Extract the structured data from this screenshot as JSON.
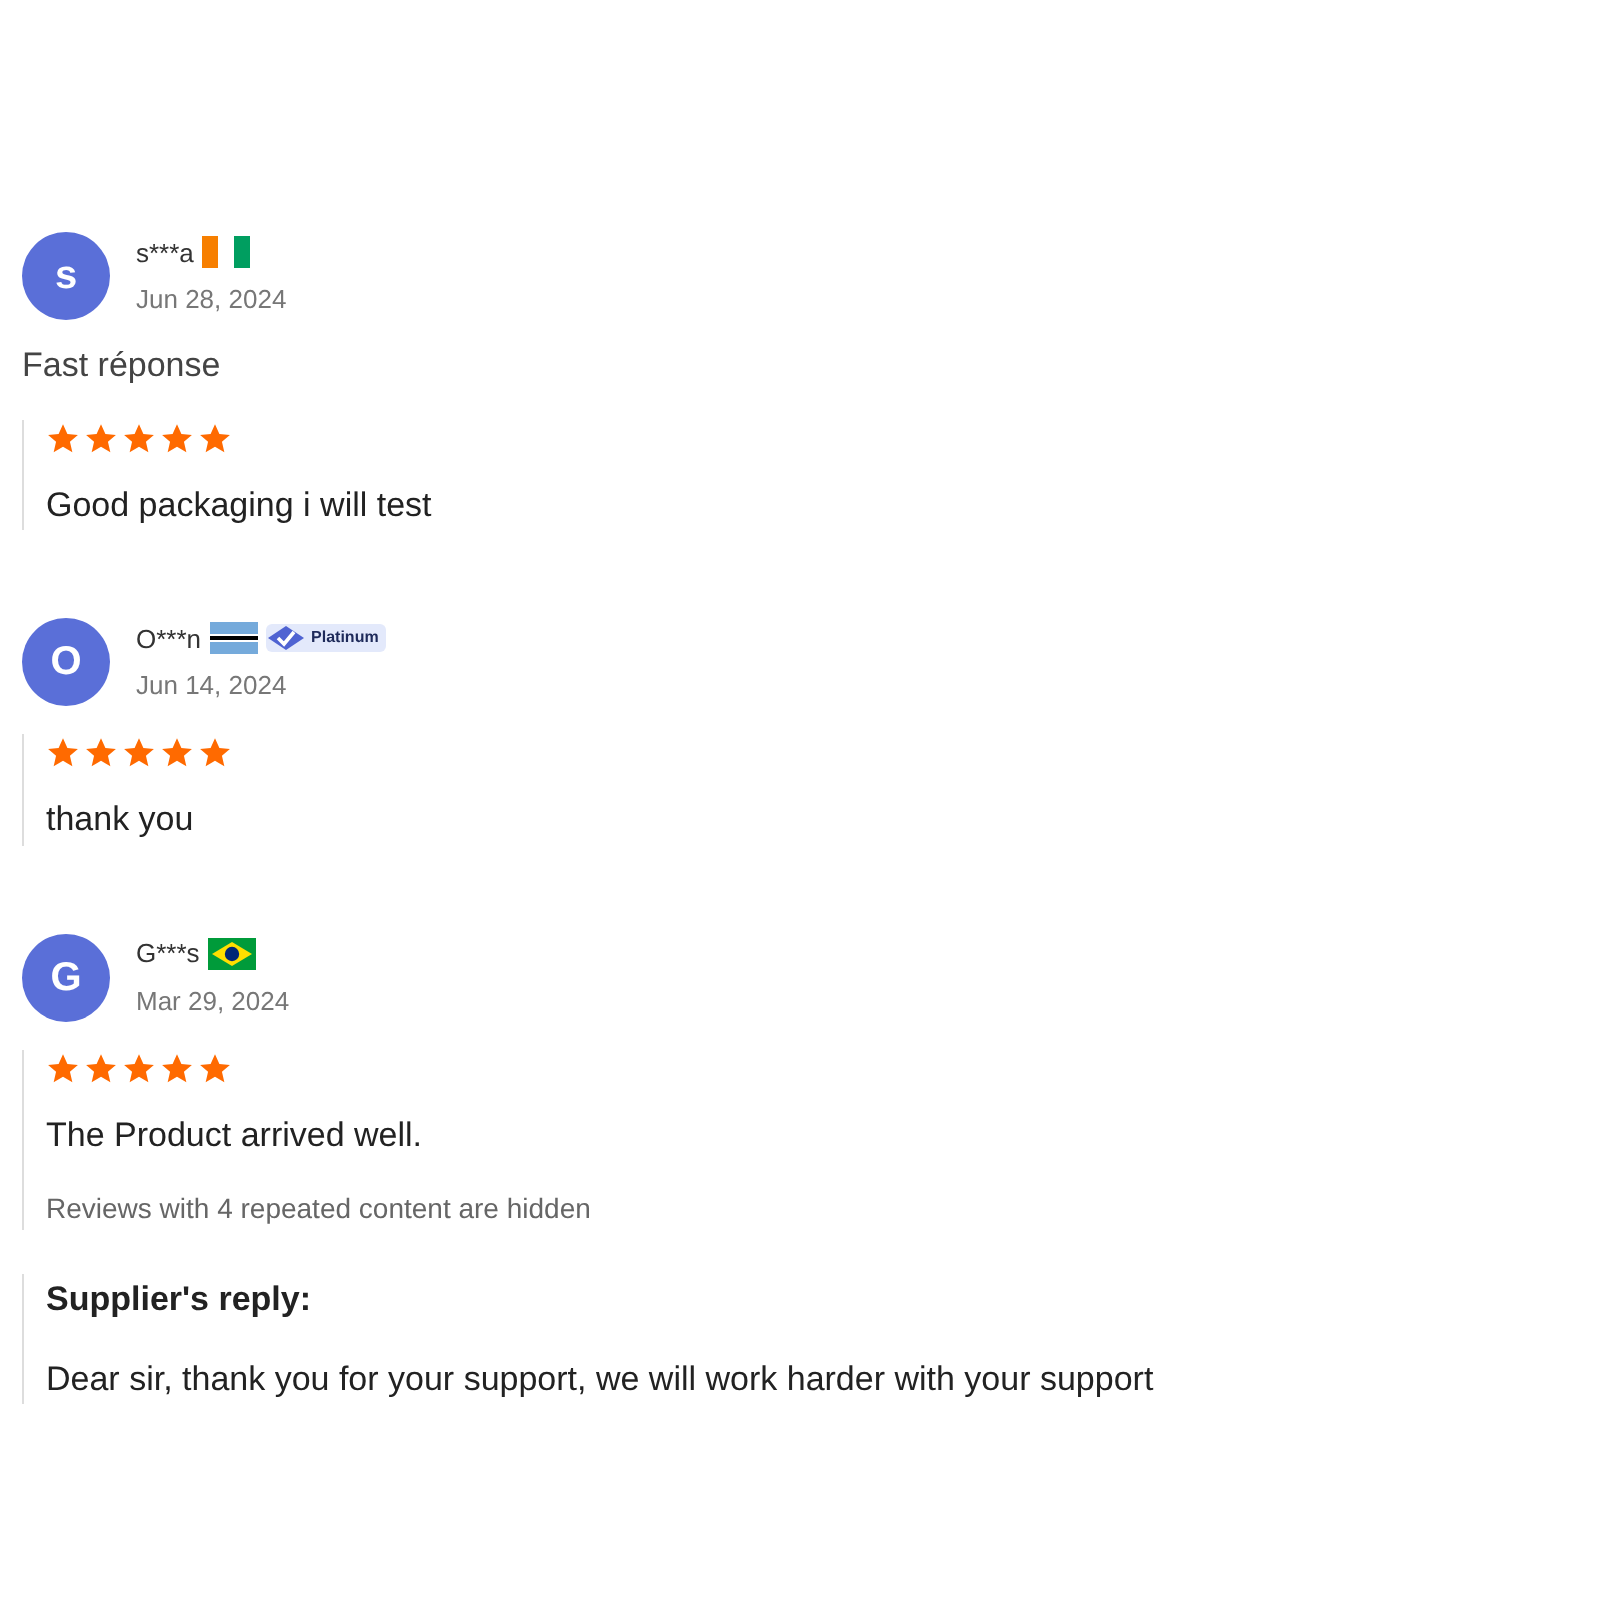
{
  "reviews": [
    {
      "initial": "s",
      "name": "s***a",
      "flag": {
        "kind": "ci"
      },
      "date": "Jun 28, 2024",
      "comment": "Fast réponse",
      "stars": 5,
      "text": "Good packaging i will test"
    },
    {
      "initial": "O",
      "name": "O***n",
      "flag": {
        "kind": "bw"
      },
      "badge": "Platinum",
      "date": "Jun 14, 2024",
      "stars": 5,
      "text": "thank you"
    },
    {
      "initial": "G",
      "name": "G***s",
      "flag": {
        "kind": "br"
      },
      "date": "Mar 29, 2024",
      "stars": 5,
      "text": "The Product arrived well.",
      "hidden_note": "Reviews with 4 repeated content are hidden",
      "reply": {
        "title": "Supplier's reply:",
        "text": "Dear sir, thank you for your support, we will work harder with your support"
      }
    }
  ]
}
